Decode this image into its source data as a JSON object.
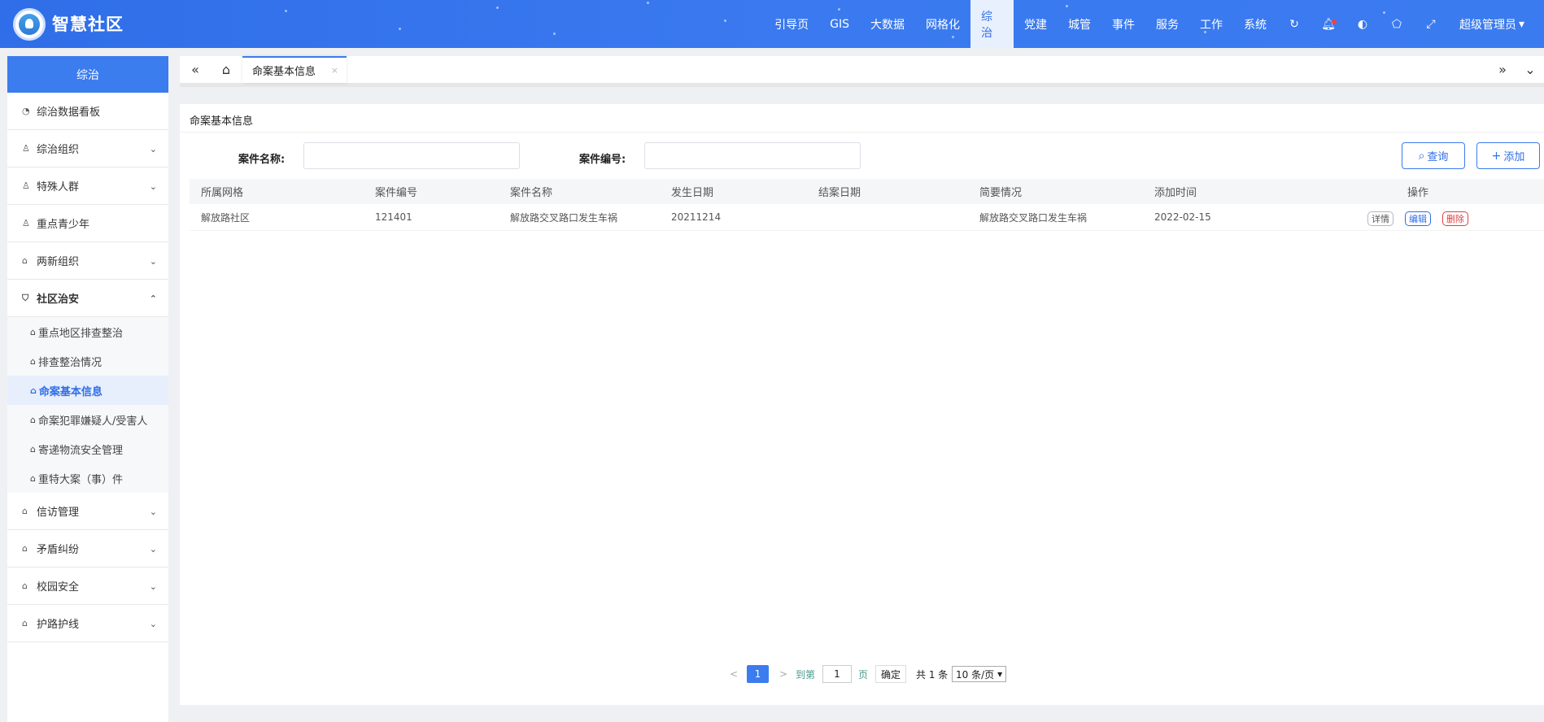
{
  "header": {
    "brand": "智慧社区",
    "nav": [
      "引导页",
      "GIS",
      "大数据",
      "网格化",
      "综治",
      "党建",
      "城管",
      "事件",
      "服务",
      "工作",
      "系统"
    ],
    "active_nav": "综治",
    "icons": [
      "refresh-icon",
      "bell-icon",
      "palette-icon",
      "tag-icon",
      "fullscreen-icon"
    ],
    "user": "超级管理员",
    "user_chevron": "▾"
  },
  "sidebar": {
    "title": "综治",
    "items": [
      {
        "label": "综治数据看板",
        "icon": "dashboard-icon",
        "chevron": ""
      },
      {
        "label": "综治组织",
        "icon": "user-icon",
        "chevron": "⌄"
      },
      {
        "label": "特殊人群",
        "icon": "user-icon",
        "chevron": "⌄"
      },
      {
        "label": "重点青少年",
        "icon": "user-icon",
        "chevron": ""
      },
      {
        "label": "两新组织",
        "icon": "home-icon",
        "chevron": "⌄"
      },
      {
        "label": "社区治安",
        "icon": "shield-icon",
        "chevron": "⌃"
      }
    ],
    "subitems": [
      "重点地区排查整治",
      "排查整治情况",
      "命案基本信息",
      "命案犯罪嫌疑人/受害人",
      "寄递物流安全管理",
      "重特大案（事）件"
    ],
    "active_sub": "命案基本信息",
    "items_after": [
      {
        "label": "信访管理",
        "chevron": "⌄"
      },
      {
        "label": "矛盾纠纷",
        "chevron": "⌄"
      },
      {
        "label": "校园安全",
        "chevron": "⌄"
      },
      {
        "label": "护路护线",
        "chevron": "⌄"
      }
    ]
  },
  "tabbar": {
    "tab_label": "命案基本信息",
    "close": "×",
    "left": "«",
    "home": "⌂",
    "right": "»",
    "down": "⌄"
  },
  "content": {
    "title": "命案基本信息",
    "filters": {
      "case_name_label": "案件名称:",
      "case_name_value": "",
      "case_no_label": "案件编号:",
      "case_no_value": ""
    },
    "buttons": {
      "search": "查询",
      "add": "添加"
    },
    "table": {
      "columns": [
        "所属网格",
        "案件编号",
        "案件名称",
        "发生日期",
        "结案日期",
        "简要情况",
        "添加时间",
        "操作"
      ],
      "rows": [
        [
          "解放路社区",
          "121401",
          "解放路交叉路口发生车祸",
          "20211214",
          "",
          "解放路交叉路口发生车祸",
          "2022-02-15"
        ]
      ],
      "actions": [
        "详情",
        "编辑",
        "删除"
      ]
    },
    "pager": {
      "prev": "<",
      "current": "1",
      "next": ">",
      "goto_label": "到第",
      "goto_value": "1",
      "page_label": "页",
      "confirm": "确定",
      "total": "共 1 条",
      "page_size": "10 条/页"
    }
  },
  "colors": {
    "header": "#2f6ee8",
    "accent": "#3b7cee",
    "danger": "#e04040"
  }
}
